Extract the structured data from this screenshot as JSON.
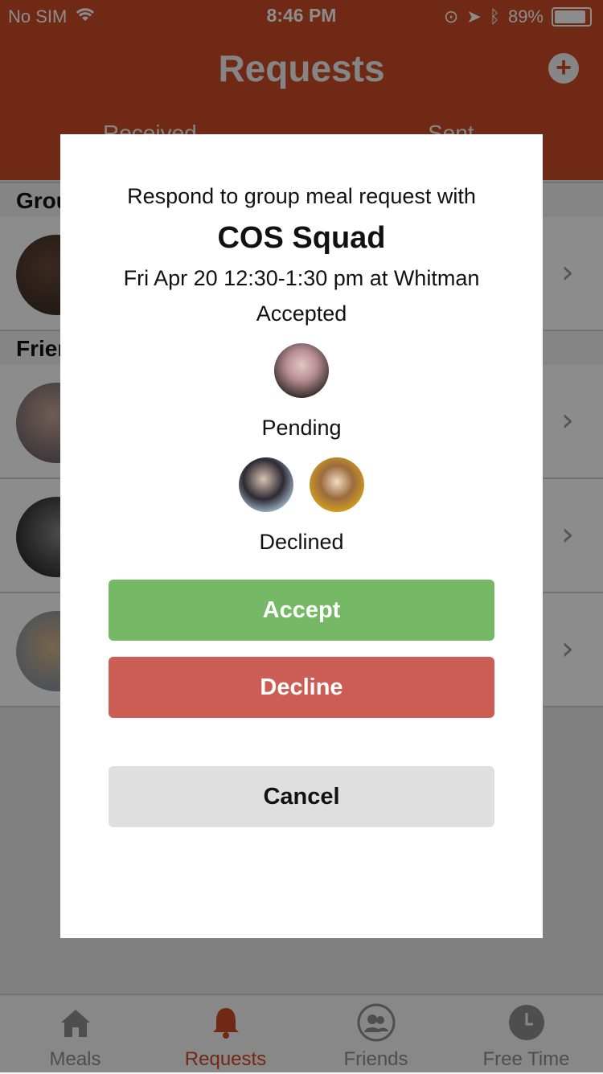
{
  "status_bar": {
    "carrier": "No SIM",
    "time": "8:46 PM",
    "battery": "89%"
  },
  "header": {
    "title": "Requests",
    "segments": [
      "Received",
      "Sent"
    ]
  },
  "sections": [
    "Groups",
    "Friends"
  ],
  "tabbar": {
    "tabs": [
      {
        "label": "Meals",
        "icon": "house-icon"
      },
      {
        "label": "Requests",
        "icon": "bell-icon",
        "active": true
      },
      {
        "label": "Friends",
        "icon": "friends-icon"
      },
      {
        "label": "Free Time",
        "icon": "clock-icon"
      }
    ],
    "accent": "#cc4b25"
  },
  "modal": {
    "intro": "Respond to group meal request with",
    "group_name": "COS Squad",
    "when": "Fri Apr 20 12:30-1:30 pm at Whitman",
    "accepted_label": "Accepted",
    "pending_label": "Pending",
    "declined_label": "Declined",
    "accept_label": "Accept",
    "decline_label": "Decline",
    "cancel_label": "Cancel"
  },
  "colors": {
    "header": "#cc4b25",
    "accept": "#75b865",
    "decline": "#cc5d55",
    "cancel": "#dfdfdf"
  }
}
